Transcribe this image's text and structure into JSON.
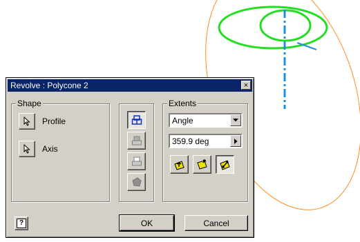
{
  "dialog": {
    "title": "Revolve : Polycone 2",
    "close_label": "×",
    "shape_group": {
      "label": "Shape",
      "profile_label": "Profile",
      "axis_label": "Axis"
    },
    "extents_group": {
      "label": "Extents",
      "type_value": "Angle",
      "angle_value": "359.9 deg"
    },
    "help_label": "?",
    "ok_label": "OK",
    "cancel_label": "Cancel"
  },
  "colors": {
    "title_bar": "#0a246a",
    "dialog_face": "#d4d0c8",
    "profile_circles": "#22dd22",
    "revolve_curve": "#ff8c1a",
    "axis_line": "#1e8fe0",
    "direction_icons": "#f0e000"
  },
  "icons": {
    "profile_select": "cursor-arrow-icon",
    "axis_select": "cursor-arrow-icon",
    "join": "join-operation-icon",
    "cut": "cut-operation-icon",
    "intersect": "intersect-operation-icon",
    "surface": "surface-output-icon",
    "direction_1": "direction-forward-icon",
    "direction_2": "direction-reverse-icon",
    "direction_3": "direction-symmetric-icon",
    "help": "help-icon"
  }
}
